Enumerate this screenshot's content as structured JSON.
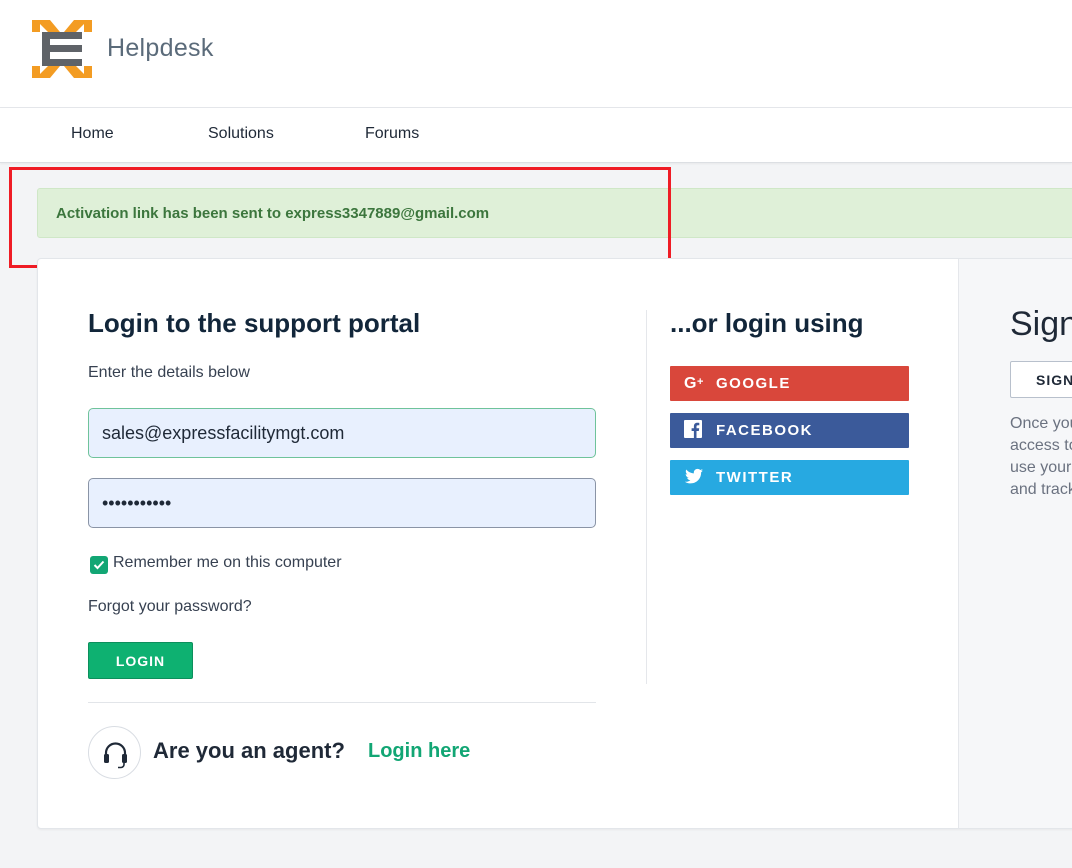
{
  "header": {
    "brand": "Helpdesk",
    "logo_icon": "helpdesk-logo-icon"
  },
  "nav": {
    "items": [
      {
        "label": "Home"
      },
      {
        "label": "Solutions"
      },
      {
        "label": "Forums"
      }
    ]
  },
  "alert": {
    "message": "Activation link has been sent to express3347889@gmail.com",
    "color": "#3c763d",
    "background": "#dff0d8"
  },
  "login": {
    "title": "Login to the support portal",
    "subtitle": "Enter the details below",
    "email_value": "sales@expressfacilitymgt.com",
    "password_value": "•••••••••••",
    "remember_label": "Remember me on this computer",
    "remember_checked": true,
    "forgot_label": "Forgot your password?",
    "login_button": "LOGIN"
  },
  "agent": {
    "question": "Are you an agent?",
    "link": "Login here",
    "icon": "headset-icon"
  },
  "social": {
    "title": "...or login using",
    "buttons": [
      {
        "label": "GOOGLE",
        "icon": "google-plus-icon",
        "color": "#d9473b"
      },
      {
        "label": "FACEBOOK",
        "icon": "facebook-icon",
        "color": "#3b5a9a"
      },
      {
        "label": "TWITTER",
        "icon": "twitter-icon",
        "color": "#27a9e1"
      }
    ]
  },
  "signup": {
    "title": "Sign",
    "button": "SIGN",
    "description_lines": [
      "Once you",
      "access to",
      "use your",
      "and track"
    ]
  },
  "colors": {
    "accent": "#12a674",
    "highlight": "#ef1c25"
  }
}
